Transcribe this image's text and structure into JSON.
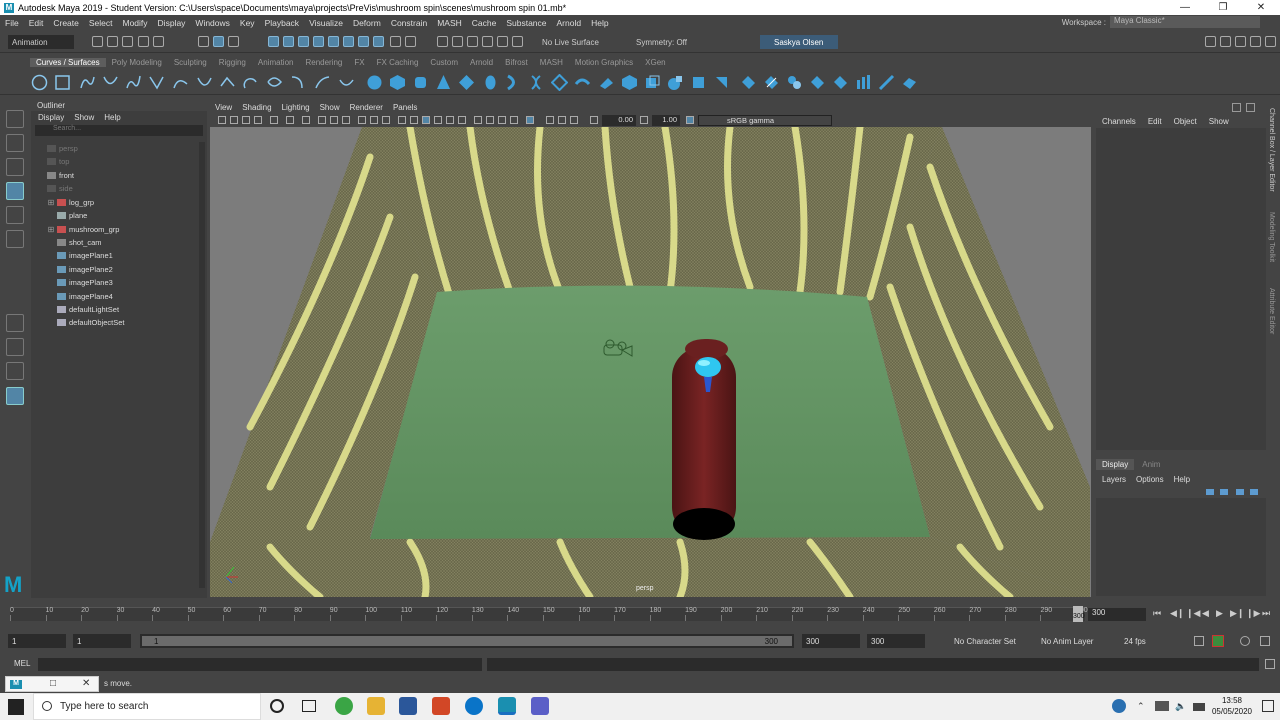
{
  "window": {
    "title": "Autodesk Maya 2019 - Student Version: C:\\Users\\space\\Documents\\maya\\projects\\PreVis\\mushroom spin\\scenes\\mushroom spin 01.mb*"
  },
  "menubar": [
    "File",
    "Edit",
    "Create",
    "Select",
    "Modify",
    "Display",
    "Windows",
    "Key",
    "Playback",
    "Visualize",
    "Deform",
    "Constrain",
    "MASH",
    "Cache",
    "Substance",
    "Arnold",
    "Help"
  ],
  "workspace": {
    "label": "Workspace :",
    "value": "Maya Classic*"
  },
  "statusline": {
    "mode": "Animation",
    "live_surface": "No Live Surface",
    "symmetry": "Symmetry: Off",
    "user": "Saskya Olsen"
  },
  "shelf_tabs": [
    "Curves / Surfaces",
    "Poly Modeling",
    "Sculpting",
    "Rigging",
    "Animation",
    "Rendering",
    "FX",
    "FX Caching",
    "Custom",
    "Arnold",
    "Bifrost",
    "MASH",
    "Motion Graphics",
    "XGen"
  ],
  "outliner": {
    "title": "Outliner",
    "menu": [
      "Display",
      "Show",
      "Help"
    ],
    "search_placeholder": "Search...",
    "items": [
      {
        "label": "persp",
        "dim": true
      },
      {
        "label": "top",
        "dim": true
      },
      {
        "label": "front",
        "dim": false
      },
      {
        "label": "side",
        "dim": true
      },
      {
        "label": "log_grp",
        "dim": false
      },
      {
        "label": "plane",
        "dim": false
      },
      {
        "label": "mushroom_grp",
        "dim": false
      },
      {
        "label": "shot_cam",
        "dim": false
      },
      {
        "label": "imagePlane1",
        "dim": false
      },
      {
        "label": "imagePlane2",
        "dim": false
      },
      {
        "label": "imagePlane3",
        "dim": false
      },
      {
        "label": "imagePlane4",
        "dim": false
      },
      {
        "label": "defaultLightSet",
        "dim": false
      },
      {
        "label": "defaultObjectSet",
        "dim": false
      }
    ]
  },
  "viewport": {
    "menu": [
      "View",
      "Shading",
      "Lighting",
      "Show",
      "Renderer",
      "Panels"
    ],
    "exposure": "0.00",
    "gamma": "1.00",
    "color_space": "sRGB gamma",
    "camera_label": "persp"
  },
  "channelbox": {
    "menu": [
      "Channels",
      "Edit",
      "Object",
      "Show"
    ]
  },
  "layer_editor": {
    "tabs": [
      "Display",
      "Anim"
    ],
    "menu": [
      "Layers",
      "Options",
      "Help"
    ]
  },
  "side_tabs": [
    "Channel Box / Layer Editor",
    "Modeling Toolkit",
    "Attribute Editor"
  ],
  "timeline": {
    "ticks": [
      "0",
      "10",
      "20",
      "30",
      "40",
      "50",
      "60",
      "70",
      "80",
      "90",
      "100",
      "110",
      "120",
      "130",
      "140",
      "150",
      "160",
      "170",
      "180",
      "190",
      "200",
      "210",
      "220",
      "230",
      "240",
      "250",
      "260",
      "270",
      "280",
      "290",
      "300"
    ],
    "current_frame": "300"
  },
  "range": {
    "start": "1",
    "start_inner": "1",
    "slider_start": "1",
    "slider_end": "300",
    "end_inner": "300",
    "end": "300",
    "character_set": "No Character Set",
    "anim_layer": "No Anim Layer",
    "fps": "24 fps"
  },
  "cmdline": {
    "label": "MEL"
  },
  "helpline": {
    "text": "s move."
  },
  "taskbar": {
    "search_placeholder": "Type here to search",
    "time": "13:58",
    "date": "05/05/2020"
  }
}
